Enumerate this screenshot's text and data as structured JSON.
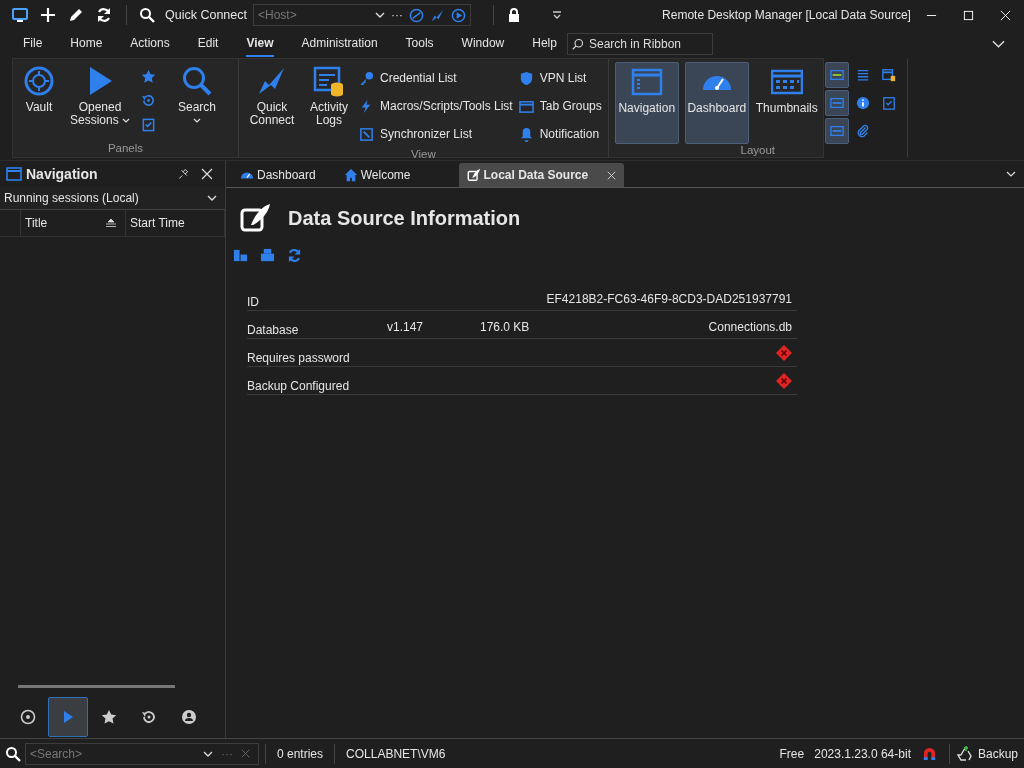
{
  "title_bar": {
    "quick_connect": "Quick Connect",
    "host": {
      "placeholder": "<Host>"
    },
    "more": "···",
    "title": "Remote Desktop Manager [Local Data Source]"
  },
  "menu": [
    {
      "label": "File",
      "selected": false
    },
    {
      "label": "Home",
      "selected": false
    },
    {
      "label": "Actions",
      "selected": false
    },
    {
      "label": "Edit",
      "selected": false
    },
    {
      "label": "View",
      "selected": true
    },
    {
      "label": "Administration",
      "selected": false
    },
    {
      "label": "Tools",
      "selected": false
    },
    {
      "label": "Window",
      "selected": false
    },
    {
      "label": "Help",
      "selected": false
    }
  ],
  "ribbon_search": {
    "placeholder": "Search in Ribbon"
  },
  "ribbon": {
    "panels": {
      "title": "Panels",
      "vault": "Vault",
      "opened_sessions": "Opened Sessions",
      "search": "Search"
    },
    "view": {
      "title": "View",
      "quick_connect": "Quick Connect",
      "activity_logs": "Activity Logs",
      "list_columns": [
        {
          "items": [
            "Credential List",
            "Macros/Scripts/Tools List",
            "Synchronizer List"
          ]
        },
        {
          "items": [
            "VPN List",
            "Tab Groups",
            "Notification"
          ]
        }
      ]
    },
    "layout": {
      "title": "Layout",
      "buttons": [
        {
          "label": "Navigation",
          "selected": true
        },
        {
          "label": "Dashboard",
          "selected": true
        },
        {
          "label": "Thumbnails",
          "selected": false
        }
      ],
      "toggles": [
        {
          "selected": true
        },
        {
          "selected": false
        },
        {
          "selected": false
        },
        {
          "selected": true
        },
        {
          "selected": false
        },
        {
          "selected": false
        },
        {
          "selected": true
        },
        {
          "selected": false
        }
      ]
    }
  },
  "navigation": {
    "title": "Navigation",
    "filter": "Running sessions (Local)",
    "columns": [
      "Title",
      "Start Time"
    ],
    "views": [
      {
        "selected": false
      },
      {
        "selected": true
      },
      {
        "selected": false
      },
      {
        "selected": false
      },
      {
        "selected": false
      }
    ]
  },
  "tabs": [
    {
      "label": "Dashboard",
      "selected": false
    },
    {
      "label": "Welcome",
      "selected": false
    },
    {
      "label": "Local Data Source",
      "selected": true
    }
  ],
  "content": {
    "heading": "Data Source Information",
    "rows": [
      {
        "label": "ID",
        "kind": "text",
        "values": [
          "EF4218B2-FC63-46F9-8CD3-DAD251937791"
        ]
      },
      {
        "label": "Database",
        "kind": "text",
        "values": [
          "v1.147",
          "176.0 KB",
          "Connections.db"
        ]
      },
      {
        "label": "Requires password",
        "kind": "flag",
        "on": false
      },
      {
        "label": "Backup Configured",
        "kind": "flag",
        "on": false
      }
    ]
  },
  "status_bar": {
    "search": {
      "placeholder": "<Search>"
    },
    "more": "···",
    "entries": "0 entries",
    "user": "COLLABNET\\VM6",
    "license": "Free",
    "version": "2023.1.23.0 64-bit",
    "backup": "Backup"
  }
}
